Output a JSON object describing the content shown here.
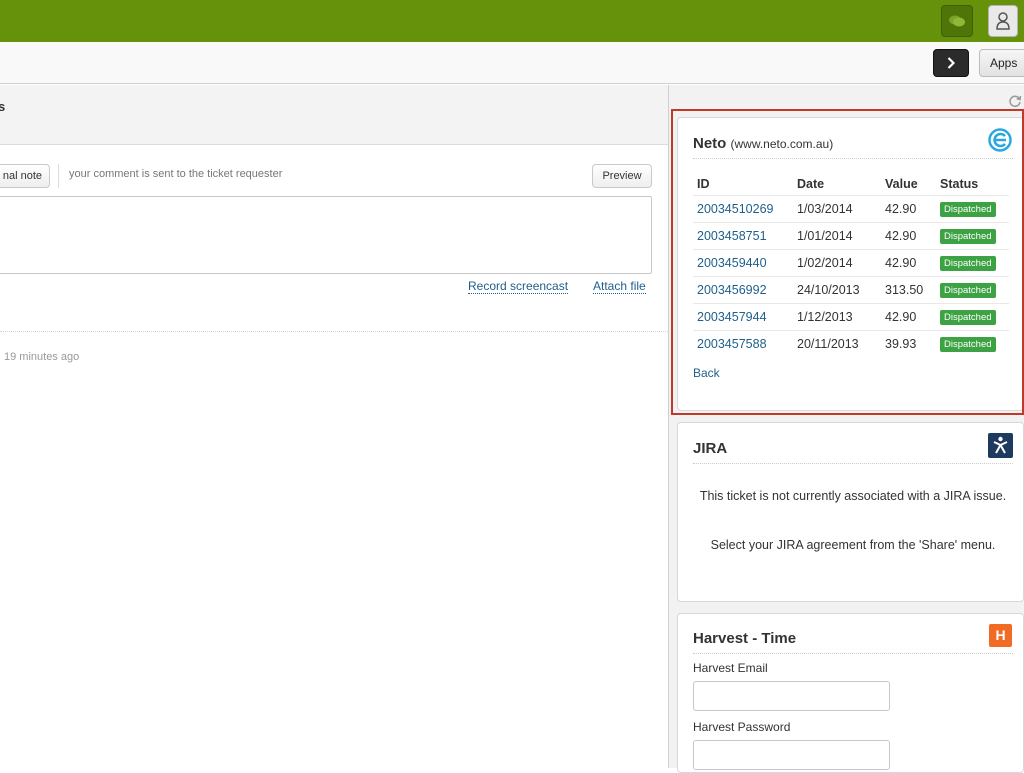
{
  "colors": {
    "topbar": "#66910b",
    "link": "#1f5f8b",
    "dispatched": "#3da244",
    "highlight_border": "#c0392b"
  },
  "header": {
    "chat_icon": "chat-bubbles-icon",
    "user_icon": "user-avatar-icon",
    "next_icon": "chevron-right-icon",
    "apps_label": "Apps"
  },
  "main": {
    "title_fragment": "s",
    "note_button_label": "nal note",
    "comment_hint": "your comment is sent to the ticket requester",
    "preview_label": "Preview",
    "record_link": "Record screencast",
    "attach_link": "Attach file",
    "time_ago": "19 minutes ago"
  },
  "neto": {
    "title": "Neto",
    "subtitle": "(www.neto.com.au)",
    "columns": [
      "ID",
      "Date",
      "Value",
      "Status"
    ],
    "rows": [
      {
        "id": "20034510269",
        "date": "1/03/2014",
        "value": "42.90",
        "status": "Dispatched"
      },
      {
        "id": "2003458751",
        "date": "1/01/2014",
        "value": "42.90",
        "status": "Dispatched"
      },
      {
        "id": "2003459440",
        "date": "1/02/2014",
        "value": "42.90",
        "status": "Dispatched"
      },
      {
        "id": "2003456992",
        "date": "24/10/2013",
        "value": "313.50",
        "status": "Dispatched"
      },
      {
        "id": "2003457944",
        "date": "1/12/2013",
        "value": "42.90",
        "status": "Dispatched"
      },
      {
        "id": "2003457588",
        "date": "20/11/2013",
        "value": "39.93",
        "status": "Dispatched"
      }
    ],
    "back_label": "Back"
  },
  "jira": {
    "title": "JIRA",
    "message1": "This ticket is not currently associated with a JIRA issue.",
    "message2": "Select your JIRA agreement from the 'Share' menu."
  },
  "harvest": {
    "title": "Harvest - Time",
    "logo_letter": "H",
    "email_label": "Harvest Email",
    "password_label": "Harvest Password"
  }
}
